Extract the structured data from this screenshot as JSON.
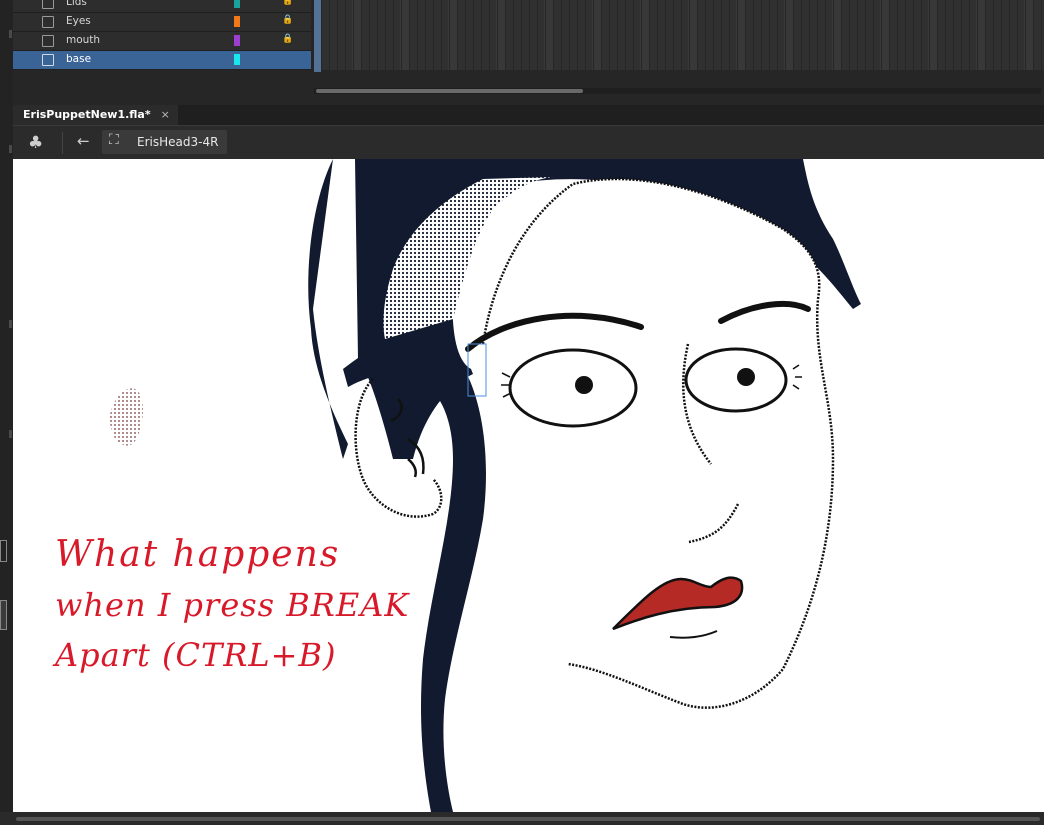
{
  "timeline": {
    "layers": [
      {
        "name": "Lids",
        "color": "#1aa39a",
        "locked": true,
        "selected": false
      },
      {
        "name": "Eyes",
        "color": "#f07a1a",
        "locked": true,
        "selected": false
      },
      {
        "name": "mouth",
        "color": "#9b3fd1",
        "locked": true,
        "selected": false
      },
      {
        "name": "base",
        "color": "#19e6ef",
        "locked": false,
        "selected": true
      }
    ]
  },
  "document": {
    "tab_title": "ErisPuppetNew1.fla*",
    "tab_close": "×"
  },
  "edit_bar": {
    "symbol_name": "ErisHead3-4R",
    "scene_icon": "club-icon",
    "back_icon": "back-arrow-icon"
  },
  "stage": {
    "annotation_lines": [
      "What happens",
      "when I press BREAK",
      "Apart (CTRL+B)"
    ],
    "colors": {
      "hair": "#111a2e",
      "lips": "#b52a25",
      "ink": "#d8192a"
    }
  }
}
